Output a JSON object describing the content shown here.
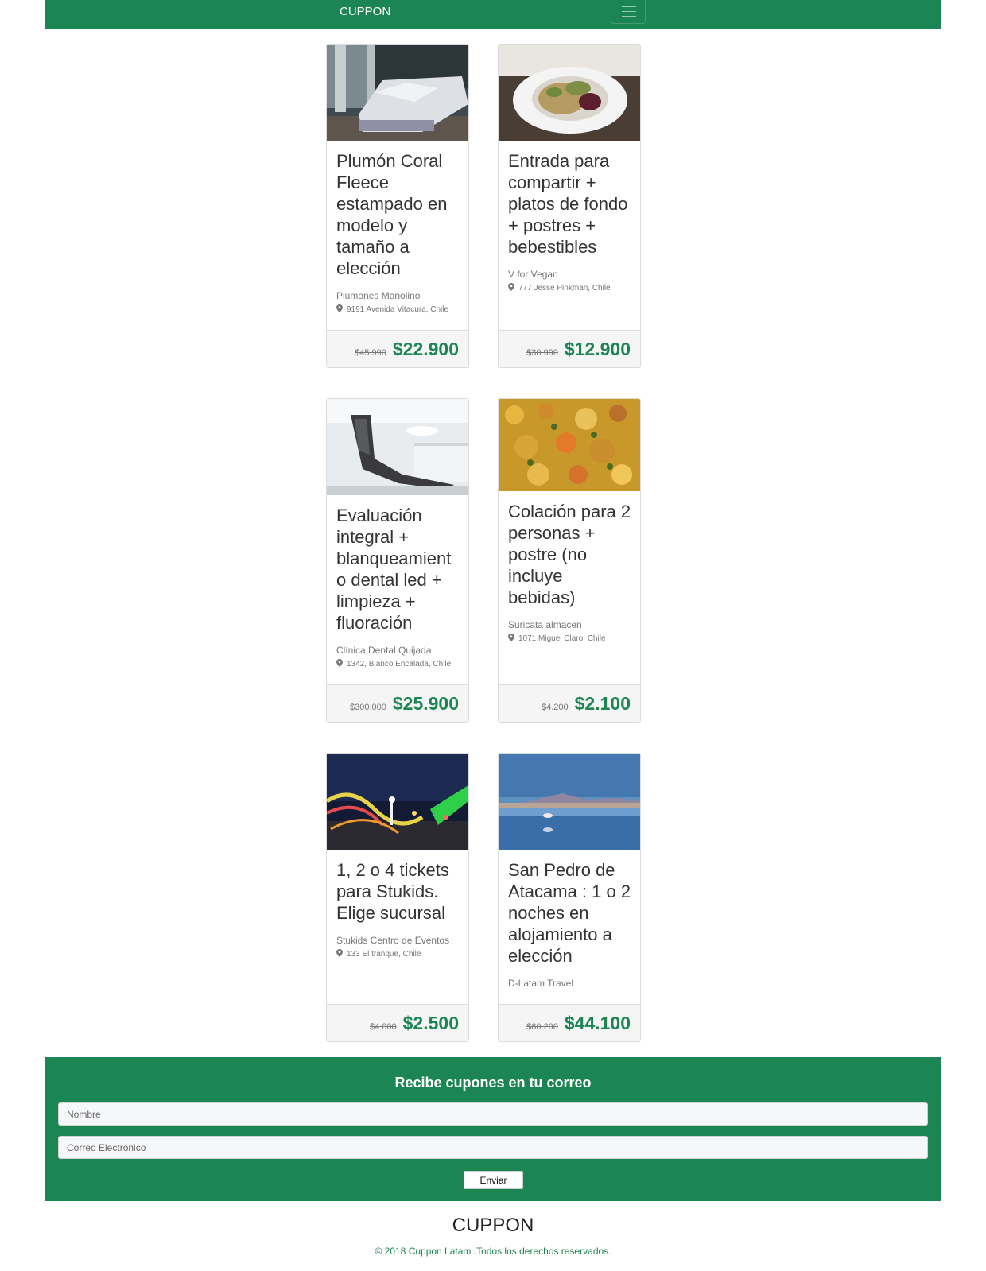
{
  "colors": {
    "brand_green": "#1c8554",
    "price_green": "#1c8554"
  },
  "navbar": {
    "brand": "CUPPON",
    "toggle_icon": "hamburger-menu-icon"
  },
  "deals": [
    {
      "title": "Plumón Coral Fleece estampado en modelo y tamaño a elección",
      "vendor": "Plumones Manolino",
      "address": "9191 Avenida Vitacura, Chile",
      "old_price": "$45.990",
      "price": "$22.900",
      "image": "bedroom-photo"
    },
    {
      "title": "Entrada para compartir + platos de fondo + postres + bebestibles",
      "vendor": "V for Vegan",
      "address": "777 Jesse Pinkman, Chile",
      "old_price": "$30.990",
      "price": "$12.900",
      "image": "vegan-dish-photo"
    },
    {
      "title": "Evaluación integral + blanqueamiento dental led + limpieza + fluoración",
      "vendor": "Clínica Dental Quijada",
      "address": "1342, Blanco Encalada, Chile",
      "old_price": "$300.000",
      "price": "$25.900",
      "image": "dental-clinic-photo"
    },
    {
      "title": "Colación para 2 personas + postre (no incluye bebidas)",
      "vendor": "Suricata almacen",
      "address": "1071 Miguel Claro, Chile",
      "old_price": "$4.200",
      "price": "$2.100",
      "image": "food-photo"
    },
    {
      "title": "1, 2 o 4 tickets para Stukids. Elige sucursal",
      "vendor": "Stukids Centro de Eventos",
      "address": "133 El tranque, Chile",
      "old_price": "$4.000",
      "price": "$2.500",
      "image": "amusement-park-photo"
    },
    {
      "title": "San Pedro de Atacama : 1 o 2 noches en alojamiento a elección",
      "vendor": "D-Latam Travel",
      "address": "",
      "old_price": "$80.200",
      "price": "$44.100",
      "image": "atacama-flamingo-photo"
    }
  ],
  "newsletter": {
    "heading": "Recibe cupones en tu correo",
    "name_placeholder": "Nombre",
    "email_placeholder": "Correo Electrónico",
    "submit_label": "Enviar"
  },
  "footer": {
    "brand": "CUPPON",
    "copyright": "© 2018 Cuppon Latam .Todos los derechos reservados."
  }
}
